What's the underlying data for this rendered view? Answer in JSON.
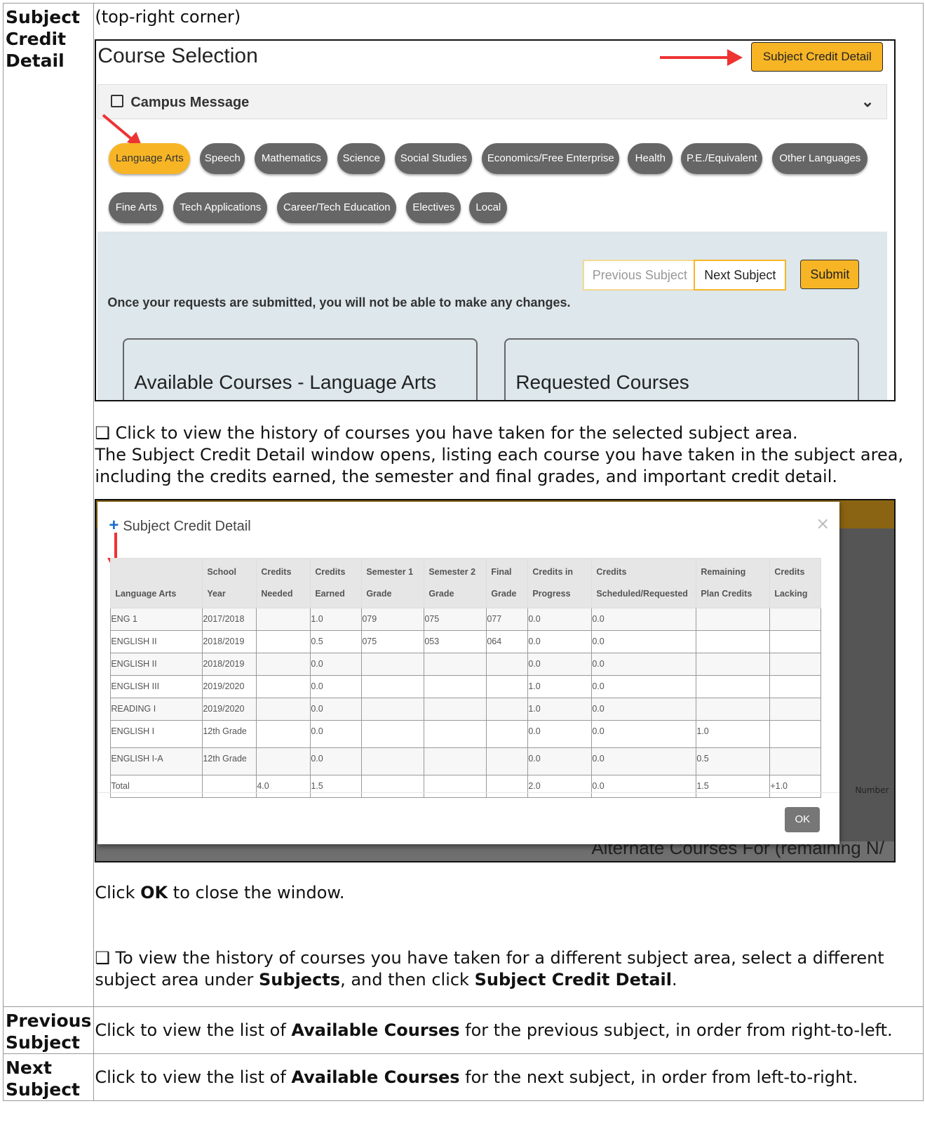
{
  "rows": [
    {
      "term": "Subject Credit Detail"
    },
    {
      "term": "Previous Subject",
      "text_pre": "Click to view the list of ",
      "bold": "Available Courses",
      "text_post": " for the previous subject, in order from right-to-left."
    },
    {
      "term": "Next Subject",
      "text_pre": "Click to view the list of ",
      "bold": "Available Courses",
      "text_post": " for the next subject, in order from left-to-right."
    }
  ],
  "intro": "(top-right corner)",
  "course_selection": {
    "title": "Course Selection",
    "subject_credit_btn": "Subject Credit Detail",
    "campus_message": "Campus Message",
    "subjects": [
      "Language Arts",
      "Speech",
      "Mathematics",
      "Science",
      "Social Studies",
      "Economics/Free Enterprise",
      "Health",
      "P.E./Equivalent",
      "Other Languages",
      "Fine Arts",
      "Tech Applications",
      "Career/Tech Education",
      "Electives",
      "Local"
    ],
    "prev_btn": "Previous Subject",
    "next_btn": "Next Subject",
    "submit_btn": "Submit",
    "warning": "Once your requests are submitted, you will not be able to make any changes.",
    "available_panel": "Available Courses - Language Arts",
    "requested_panel": "Requested Courses"
  },
  "desc1_line1": "❑ Click to view the history of courses you have taken for the selected subject area.",
  "desc1_line2": "The Subject Credit Detail window opens, listing each course you have taken in the subject area, including the credits earned, the semester and final grades, and important credit detail.",
  "modal": {
    "title": "Subject Credit Detail",
    "close": "×",
    "ok": "OK",
    "headers": [
      "Language Arts",
      "School Year",
      "Credits Needed",
      "Credits Earned",
      "Semester 1 Grade",
      "Semester 2 Grade",
      "Final Grade",
      "Credits in Progress",
      "Credits Scheduled/Requested",
      "Remaining Plan Credits",
      "Credits Lacking"
    ],
    "rows": [
      [
        "ENG 1",
        "2017/2018",
        "",
        "1.0",
        "079",
        "075",
        "077",
        "0.0",
        "0.0",
        "",
        ""
      ],
      [
        "ENGLISH II",
        "2018/2019",
        "",
        "0.5",
        "075",
        "053",
        "064",
        "0.0",
        "0.0",
        "",
        ""
      ],
      [
        "ENGLISH II",
        "2018/2019",
        "",
        "0.0",
        "",
        "",
        "",
        "0.0",
        "0.0",
        "",
        ""
      ],
      [
        "ENGLISH III",
        "2019/2020",
        "",
        "0.0",
        "",
        "",
        "",
        "1.0",
        "0.0",
        "",
        ""
      ],
      [
        "READING I",
        "2019/2020",
        "",
        "0.0",
        "",
        "",
        "",
        "1.0",
        "0.0",
        "",
        ""
      ],
      [
        "ENGLISH I",
        "12th Grade",
        "",
        "0.0",
        "",
        "",
        "",
        "0.0",
        "0.0",
        "1.0",
        ""
      ],
      [
        "ENGLISH I-A",
        "12th Grade",
        "",
        "0.0",
        "",
        "",
        "",
        "0.0",
        "0.0",
        "0.5",
        ""
      ],
      [
        "Total",
        "",
        "4.0",
        "1.5",
        "",
        "",
        "",
        "2.0",
        "0.0",
        "1.5",
        "+1.0"
      ]
    ],
    "bg_number": "Number",
    "bg_alternate": "Alternate Courses For (remaining N/"
  },
  "ok_text_pre": "Click ",
  "ok_text_bold": "OK",
  "ok_text_post": " to close the window.",
  "desc2_pre": "❑ To view the history of courses you have taken for a different subject area, select a different subject area under ",
  "desc2_bold1": "Subjects",
  "desc2_mid": ", and then click ",
  "desc2_bold2": "Subject Credit Detail",
  "desc2_post": "."
}
